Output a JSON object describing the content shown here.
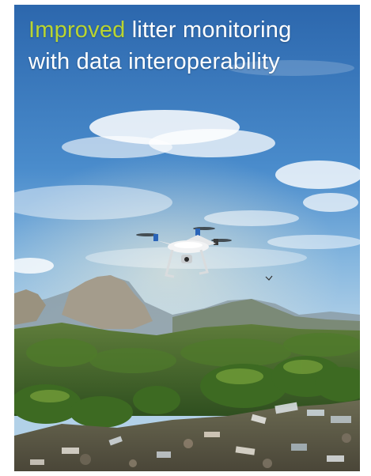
{
  "headline": {
    "accent_word": "Improved",
    "line1_rest": " litter monitoring",
    "line2": "with data interoperability"
  },
  "colors": {
    "accent": "#b9d531",
    "headline_text": "#ffffff",
    "sky_top": "#2f6fb4",
    "sky_horizon": "#a9cde8",
    "vegetation": "#3f6a2a"
  },
  "image": {
    "subject": "quadcopter-drone",
    "background": "sky-clouds-mountains",
    "foreground": "litter-on-ground"
  }
}
